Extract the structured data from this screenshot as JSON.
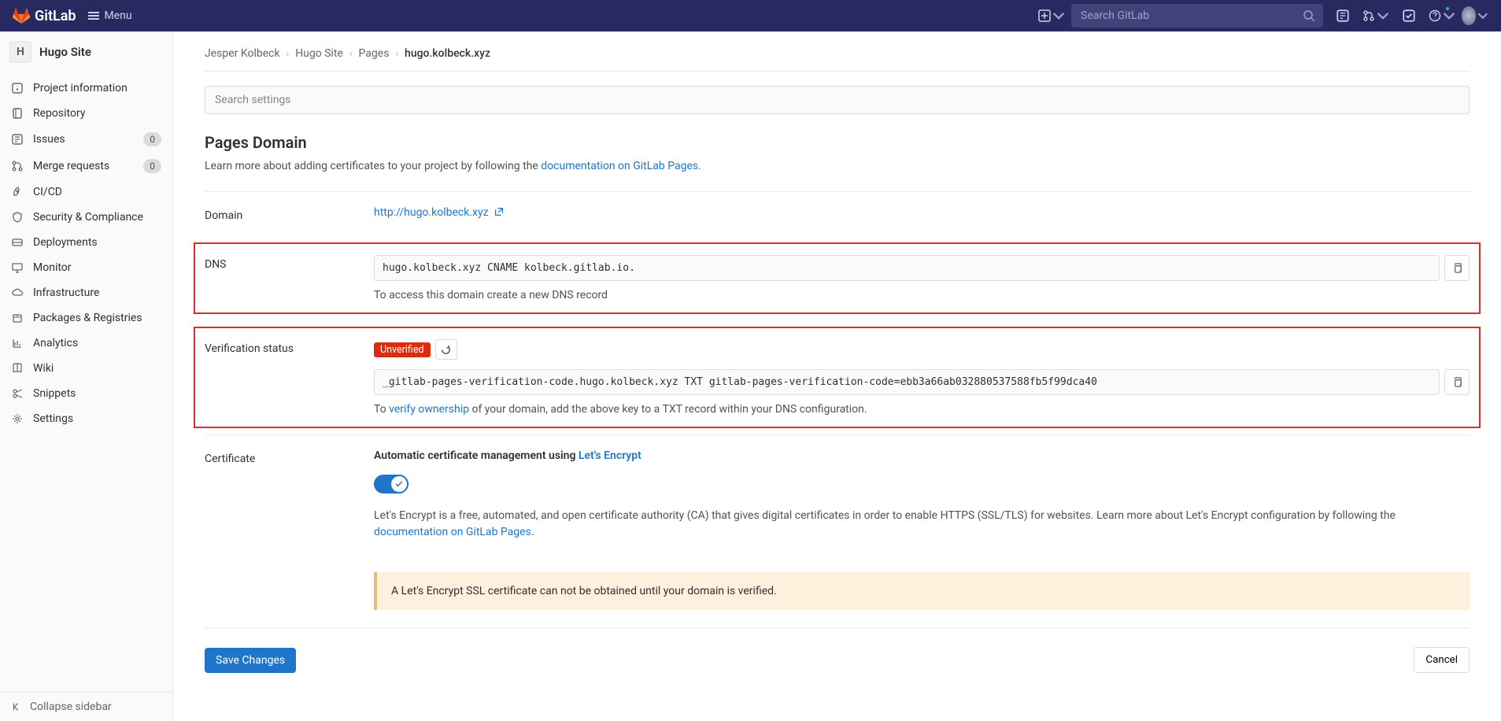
{
  "topbar": {
    "brand": "GitLab",
    "menu": "Menu",
    "search_placeholder": "Search GitLab"
  },
  "sidebar": {
    "project_initial": "H",
    "project_name": "Hugo Site",
    "items": [
      {
        "label": "Project information"
      },
      {
        "label": "Repository"
      },
      {
        "label": "Issues",
        "badge": "0"
      },
      {
        "label": "Merge requests",
        "badge": "0"
      },
      {
        "label": "CI/CD"
      },
      {
        "label": "Security & Compliance"
      },
      {
        "label": "Deployments"
      },
      {
        "label": "Monitor"
      },
      {
        "label": "Infrastructure"
      },
      {
        "label": "Packages & Registries"
      },
      {
        "label": "Analytics"
      },
      {
        "label": "Wiki"
      },
      {
        "label": "Snippets"
      },
      {
        "label": "Settings"
      }
    ],
    "collapse": "Collapse sidebar"
  },
  "breadcrumb": {
    "user": "Jesper Kolbeck",
    "project": "Hugo Site",
    "section": "Pages",
    "current": "hugo.kolbeck.xyz"
  },
  "search_settings_placeholder": "Search settings",
  "page": {
    "title": "Pages Domain",
    "desc_pre": "Learn more about adding certificates to your project by following the ",
    "desc_link": "documentation on GitLab Pages",
    "desc_post": "."
  },
  "domain": {
    "label": "Domain",
    "url": "http://hugo.kolbeck.xyz"
  },
  "dns": {
    "label": "DNS",
    "record": "hugo.kolbeck.xyz CNAME kolbeck.gitlab.io.",
    "hint": "To access this domain create a new DNS record"
  },
  "verification": {
    "label": "Verification status",
    "badge": "Unverified",
    "record": "_gitlab-pages-verification-code.hugo.kolbeck.xyz TXT gitlab-pages-verification-code=ebb3a66ab032880537588fb5f99dca40",
    "hint_pre": "To ",
    "hint_link": "verify ownership",
    "hint_post": " of your domain, add the above key to a TXT record within your DNS configuration."
  },
  "certificate": {
    "label": "Certificate",
    "heading_pre": "Automatic certificate management using ",
    "heading_link": "Let's Encrypt",
    "desc_pre": "Let's Encrypt is a free, automated, and open certificate authority (CA) that gives digital certificates in order to enable HTTPS (SSL/TLS) for websites. Learn more about Let's Encrypt configuration by following the ",
    "desc_link": "documentation on GitLab Pages",
    "desc_post": "."
  },
  "warning": "A Let's Encrypt SSL certificate can not be obtained until your domain is verified.",
  "buttons": {
    "save": "Save Changes",
    "cancel": "Cancel"
  }
}
